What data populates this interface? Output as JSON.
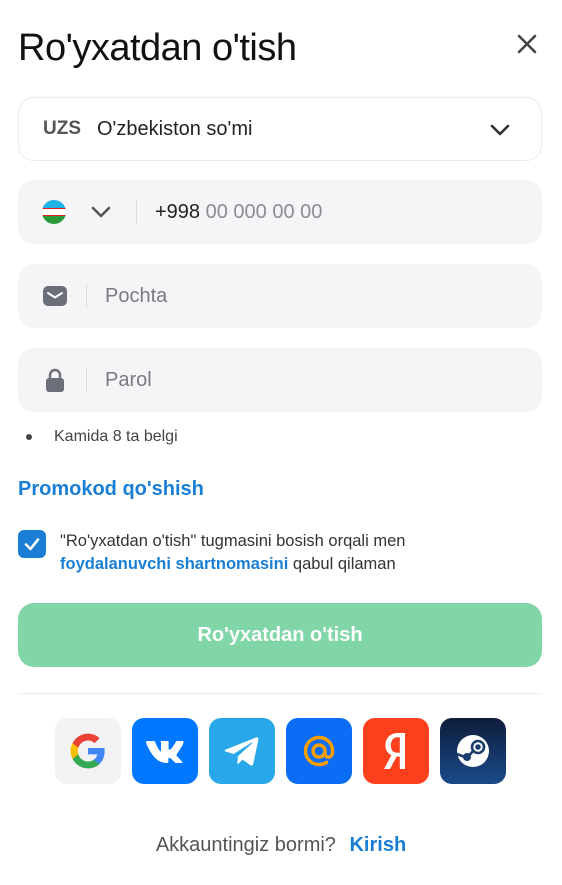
{
  "header": {
    "title": "Ro'yxatdan o'tish"
  },
  "currency": {
    "code": "UZS",
    "name": "O'zbekiston so'mi"
  },
  "phone": {
    "prefix": "+998",
    "placeholder": "00 000 00 00"
  },
  "email": {
    "placeholder": "Pochta"
  },
  "password": {
    "placeholder": "Parol",
    "hint": "Kamida 8 ta belgi"
  },
  "promo": {
    "label": "Promokod qo'shish"
  },
  "agreement": {
    "checked": true,
    "text_before": "\"Ro'yxatdan o'tish\" tugmasini bosish orqali men",
    "link": "foydalanuvchi shartnomasini",
    "text_after": "qabul qilaman"
  },
  "submit": {
    "label": "Ro'yxatdan o'tish"
  },
  "socials": [
    "google-icon",
    "vk-icon",
    "telegram-icon",
    "mail-ru-icon",
    "yandex-icon",
    "steam-icon"
  ],
  "footer": {
    "question": "Akkauntingiz bormi?",
    "login": "Kirish"
  },
  "colors": {
    "accent": "#1a7fd4",
    "submit": "#80d6a6"
  }
}
